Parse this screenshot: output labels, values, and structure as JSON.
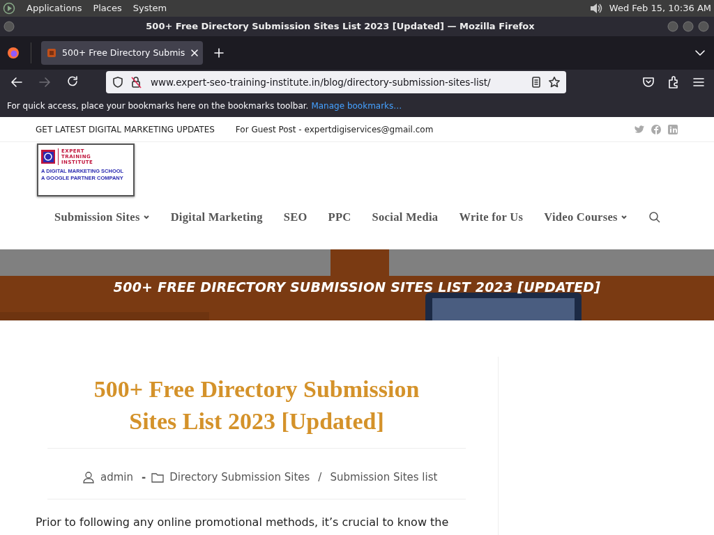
{
  "desktop_panel": {
    "menus": [
      "Applications",
      "Places",
      "System"
    ],
    "clock": "Wed Feb 15, 10:36 AM"
  },
  "window": {
    "title": "500+ Free Directory Submission Sites List 2023 [Updated] — Mozilla Firefox"
  },
  "tabs": [
    {
      "label": "500+ Free Directory Submis",
      "selected": true
    }
  ],
  "toolbar": {
    "buttons": [
      {
        "kind": "back",
        "disabled": false
      },
      {
        "kind": "forward",
        "disabled": true
      },
      {
        "kind": "reload",
        "disabled": false
      }
    ],
    "url": "www.expert-seo-training-institute.in/blog/directory-submission-sites-list/"
  },
  "bookmarks_bar": {
    "text": "For quick access, place your bookmarks here on the bookmarks toolbar.",
    "link": "Manage bookmarks…"
  },
  "site_topbar": {
    "left": [
      "GET LATEST DIGITAL MARKETING UPDATES",
      "For Guest Post - expertdigiservices@gmail.com"
    ]
  },
  "logo": {
    "lines": [
      "EXPERT",
      "TRAINING",
      "INSTITUTE"
    ],
    "taglines": [
      "A DIGITAL MARKETING SCHOOL",
      "A GOOGLE PARTNER COMPANY"
    ]
  },
  "nav": [
    {
      "label": "Submission Sites",
      "has_menu": true
    },
    {
      "label": "Digital Marketing",
      "has_menu": false
    },
    {
      "label": "SEO",
      "has_menu": false
    },
    {
      "label": "PPC",
      "has_menu": false
    },
    {
      "label": "Social Media",
      "has_menu": false
    },
    {
      "label": "Write for Us",
      "has_menu": false
    },
    {
      "label": "Video Courses",
      "has_menu": true
    }
  ],
  "hero": {
    "title": "500+ FREE DIRECTORY SUBMISSION SITES LIST 2023 [UPDATED]"
  },
  "article": {
    "title": "500+ Free Directory Submission Sites List 2023 [Updated]",
    "author": "admin",
    "dash": "-",
    "categories": [
      "Directory Submission Sites",
      "Submission Sites list"
    ],
    "separator": "/",
    "intro": "Prior to following any online promotional methods, it’s crucial to know the"
  }
}
